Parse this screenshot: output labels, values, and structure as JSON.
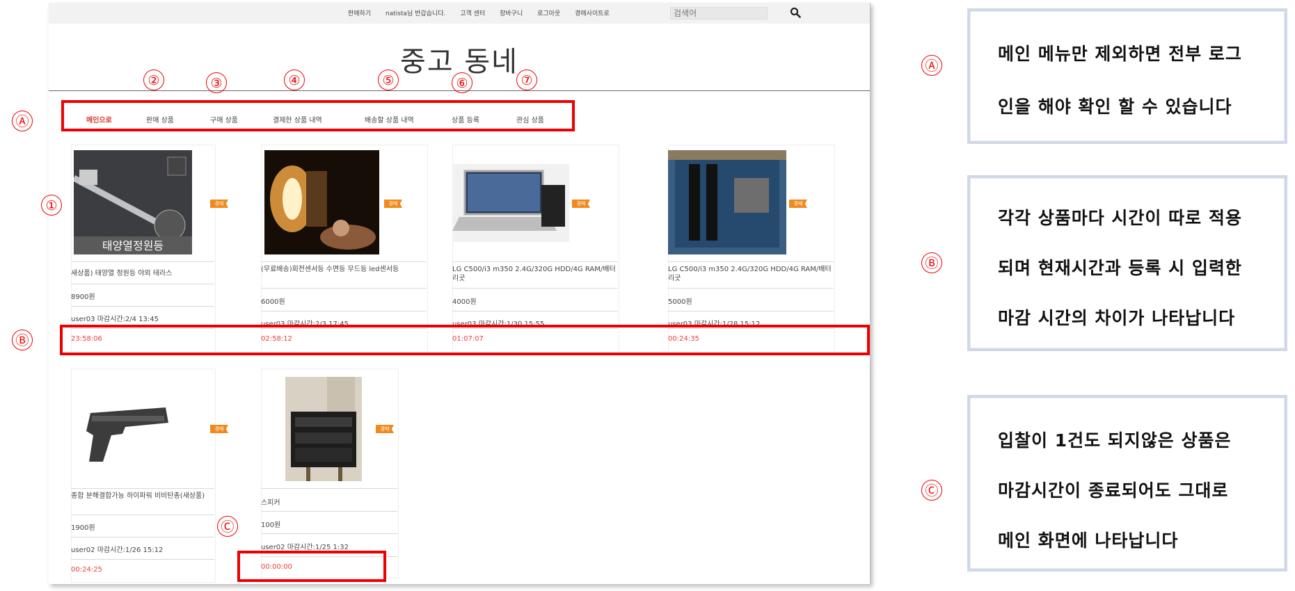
{
  "top_links": [
    "판매하기",
    "natista님 반갑습니다.",
    "고객 센터",
    "장바구니",
    "로그아웃",
    "경매사이트로"
  ],
  "search": {
    "placeholder": "검색어"
  },
  "site_title": "중고 동네",
  "nav": [
    "메인으로",
    "판매 상품",
    "구매 상품",
    "결제한 상품 내역",
    "배송할 상품 내역",
    "상품 등록",
    "관심 상품"
  ],
  "badge_label": "경매",
  "products": [
    {
      "name": "새상품) 태양열 정원등 야외 테라스",
      "price": "8900원",
      "seller": "user03 마감시간:2/4 13:45",
      "timer": "23:58:06",
      "photo_caption": "태양열정원등"
    },
    {
      "name": "(무료배송)회전센서등 수면등 무드등 led센서등",
      "price": "6000원",
      "seller": "user03 마감시간:2/3 17:45",
      "timer": "02:58:12"
    },
    {
      "name": "LG C500/i3 m350 2.4G/320G HDD/4G RAM/배터리굿",
      "price": "4000원",
      "seller": "user03 마감시간:1/30 15:55",
      "timer": "01:07:07"
    },
    {
      "name": "LG C500/i3 m350 2.4G/320G HDD/4G RAM/배터리굿",
      "price": "5000원",
      "seller": "user03 마감시간:1/28 15:12",
      "timer": "00:24:35"
    },
    {
      "name": "종합 분해결합가능 하이파워 비비탄총(새상품)",
      "price": "1900원",
      "seller": "user02 마감시간:1/26 15:12",
      "timer": "00:24:25"
    },
    {
      "name": "스피커",
      "price": "100원",
      "seller": "user02 마감시간:1/25 1:32",
      "timer": "00:00:00"
    }
  ],
  "annotations": {
    "markers": [
      "①",
      "②",
      "③",
      "④",
      "⑤",
      "⑥",
      "⑦",
      "Ⓐ",
      "Ⓑ",
      "Ⓒ"
    ],
    "notes": [
      {
        "marker": "Ⓐ",
        "lines": [
          "메인 메뉴만 제외하면 전부 로그",
          "인을 해야 확인 할 수 있습니다"
        ]
      },
      {
        "marker": "Ⓑ",
        "lines": [
          "각각 상품마다 시간이 따로 적용",
          "되며 현재시간과 등록 시 입력한",
          "마감 시간의 차이가 나타납니다"
        ]
      },
      {
        "marker": "Ⓒ",
        "lines": [
          "입찰이 1건도 되지않은 상품은",
          "마감시간이 종료되어도 그대로",
          "메인 화면에 나타납니다"
        ]
      }
    ]
  },
  "colors": {
    "accent_red": "#e00000",
    "timer_red": "#e8403a",
    "badge_orange": "#f08a1c",
    "note_border": "#cfd8e8"
  }
}
